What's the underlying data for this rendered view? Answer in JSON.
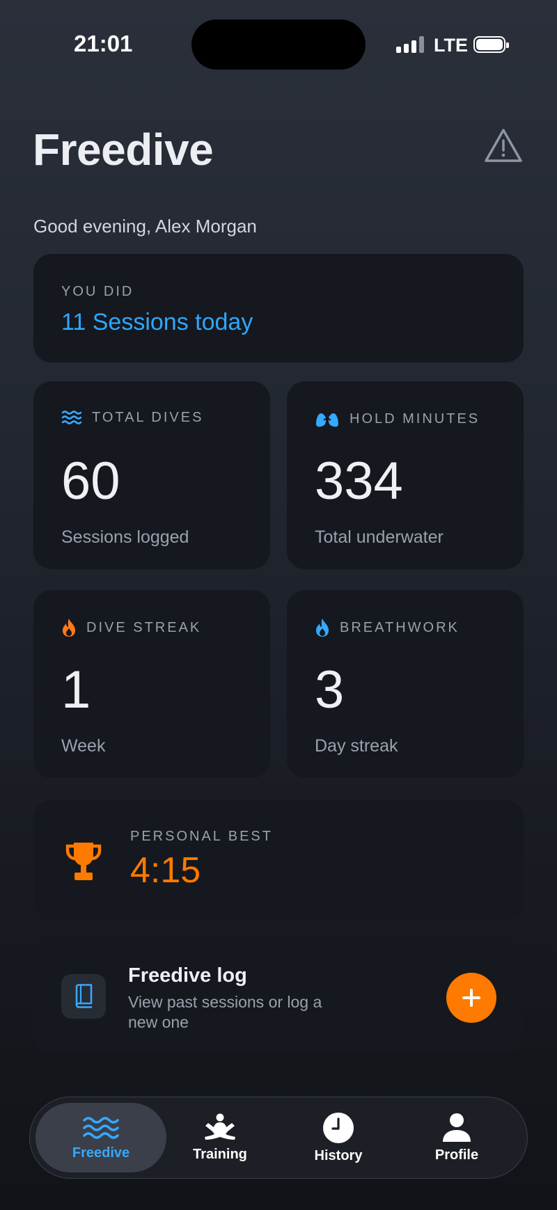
{
  "status_bar": {
    "time": "21:01",
    "network": "LTE"
  },
  "header": {
    "title": "Freedive",
    "warning_icon": "warning-triangle-icon"
  },
  "greeting": "Good evening, Alex Morgan",
  "sessions_card": {
    "label": "YOU DID",
    "value": "11 Sessions today"
  },
  "stats": [
    {
      "label": "TOTAL DIVES",
      "value": "60",
      "sub": "Sessions logged",
      "icon": "waves-icon",
      "icon_color": "#36a8ff"
    },
    {
      "label": "HOLD MINUTES",
      "value": "334",
      "sub": "Total underwater",
      "icon": "lungs-icon",
      "icon_color": "#36a8ff"
    },
    {
      "label": "DIVE STREAK",
      "value": "1",
      "sub": "Week",
      "icon": "flame-icon",
      "icon_color": "#ff7a1a"
    },
    {
      "label": "BREATHWORK",
      "value": "3",
      "sub": "Day streak",
      "icon": "droplet-flame-icon",
      "icon_color": "#36a8ff"
    }
  ],
  "personal_best": {
    "label": "PERSONAL BEST",
    "value": "4:15",
    "icon": "trophy-icon",
    "color": "#ff7a00"
  },
  "log_card": {
    "title": "Freedive log",
    "subtitle_line1": "View past sessions or log a",
    "subtitle_line2": "new one",
    "icon": "book-icon",
    "action_icon": "plus-icon"
  },
  "nav": {
    "items": [
      {
        "label": "Freedive",
        "icon": "waves-icon",
        "active": true
      },
      {
        "label": "Training",
        "icon": "meditation-icon",
        "active": false
      },
      {
        "label": "History",
        "icon": "clock-icon",
        "active": false
      },
      {
        "label": "Profile",
        "icon": "person-icon",
        "active": false
      }
    ]
  },
  "colors": {
    "accent_blue": "#2ea7ff",
    "accent_orange": "#ff7a00",
    "card_bg": "#15181e"
  }
}
